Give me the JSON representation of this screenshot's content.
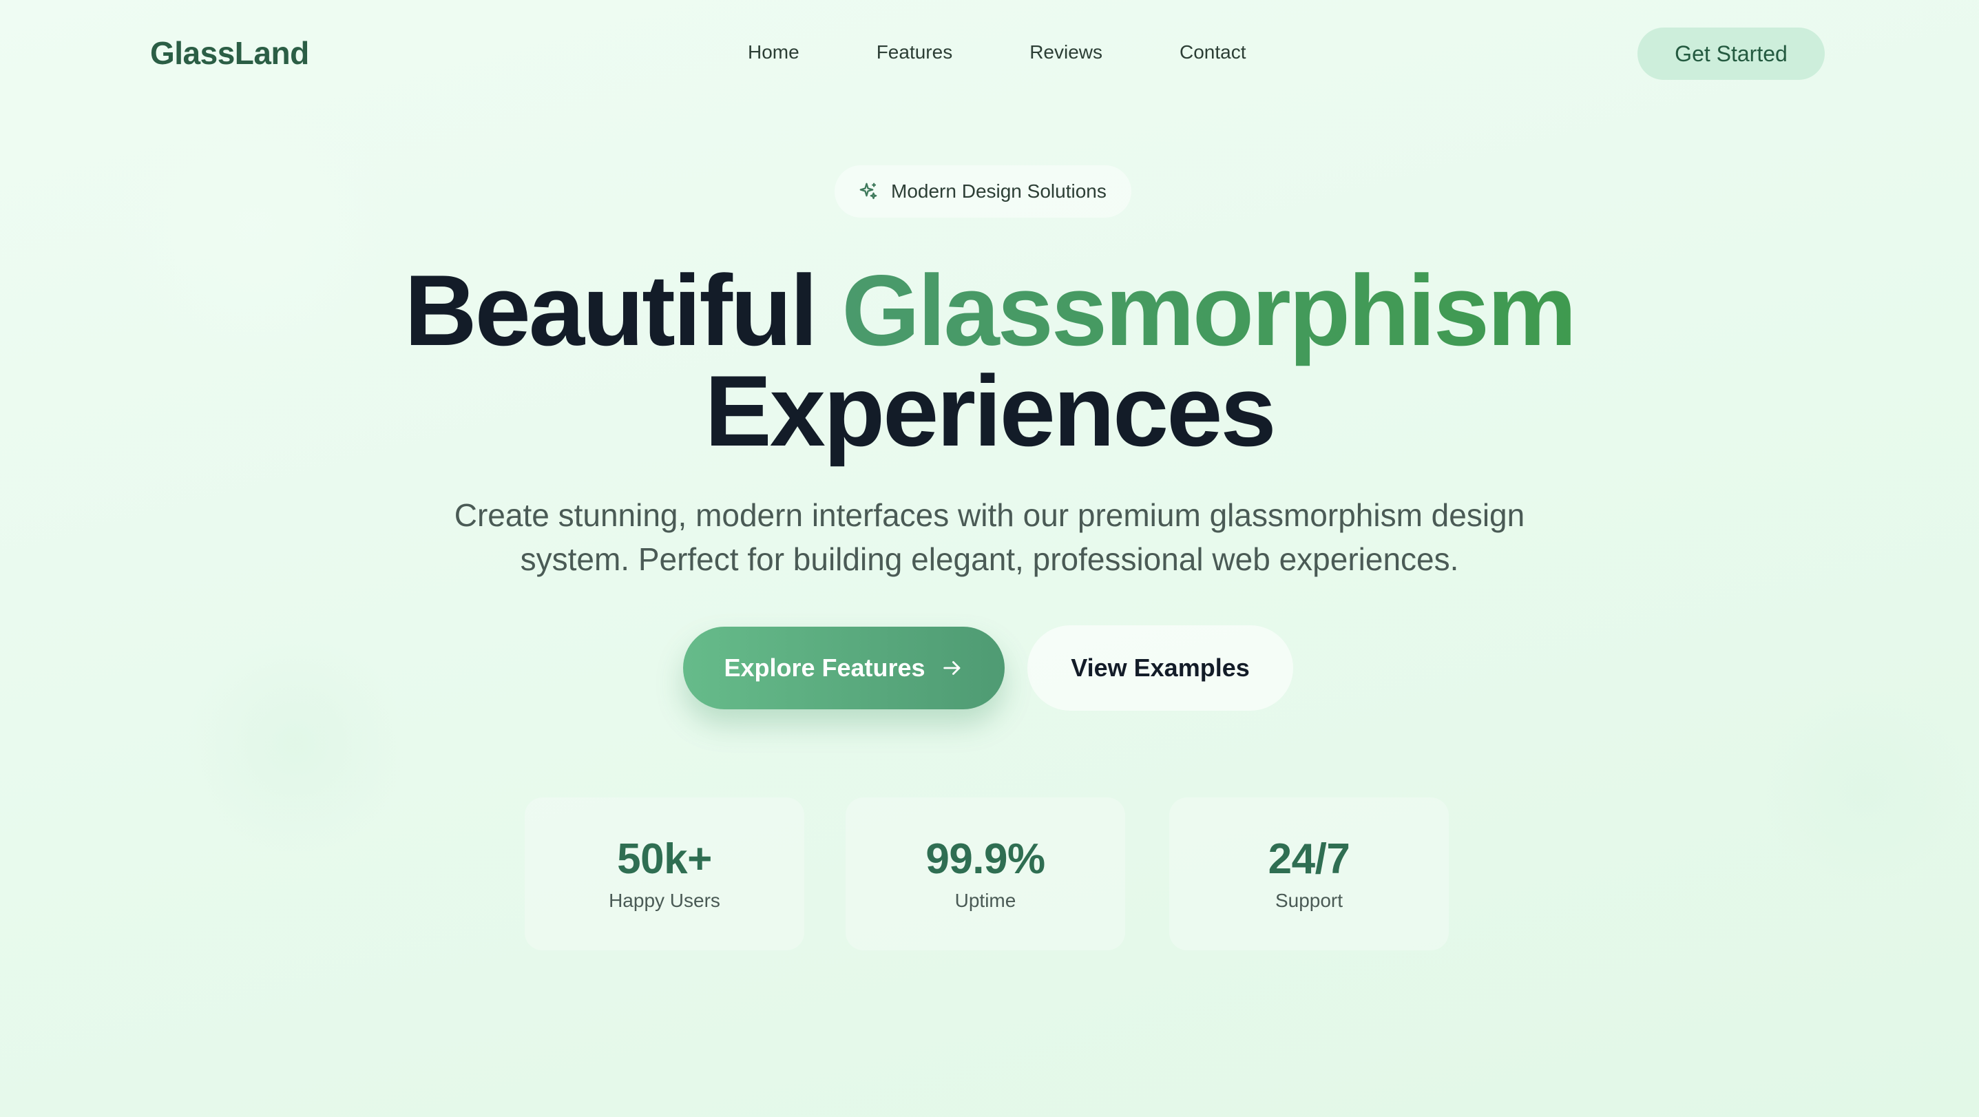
{
  "nav": {
    "logo": "GlassLand",
    "links": [
      "Home",
      "Features",
      "Reviews",
      "Contact"
    ],
    "cta_label": "Get Started"
  },
  "hero": {
    "badge_icon": "sparkles-icon",
    "badge_text": "Modern Design Solutions",
    "headline_part1": "Beautiful ",
    "headline_accent": "Glassmorphism",
    "headline_part2": "Experiences",
    "subtitle": "Create stunning, modern interfaces with our premium glassmorphism design system. Perfect for building elegant, professional web experiences.",
    "primary_button": "Explore Features",
    "primary_button_icon": "arrow-right-icon",
    "secondary_button": "View Examples"
  },
  "stats": [
    {
      "value": "50k+",
      "label": "Happy Users"
    },
    {
      "value": "99.9%",
      "label": "Uptime"
    },
    {
      "value": "24/7",
      "label": "Support"
    }
  ],
  "colors": {
    "brand": "#2b5e45",
    "accent_gradient_start": "#66bb8a",
    "accent_gradient_end": "#4f9b73",
    "headline_accent": "#4a9a6c",
    "headline_text": "#131c28",
    "background": "#e9faee"
  }
}
